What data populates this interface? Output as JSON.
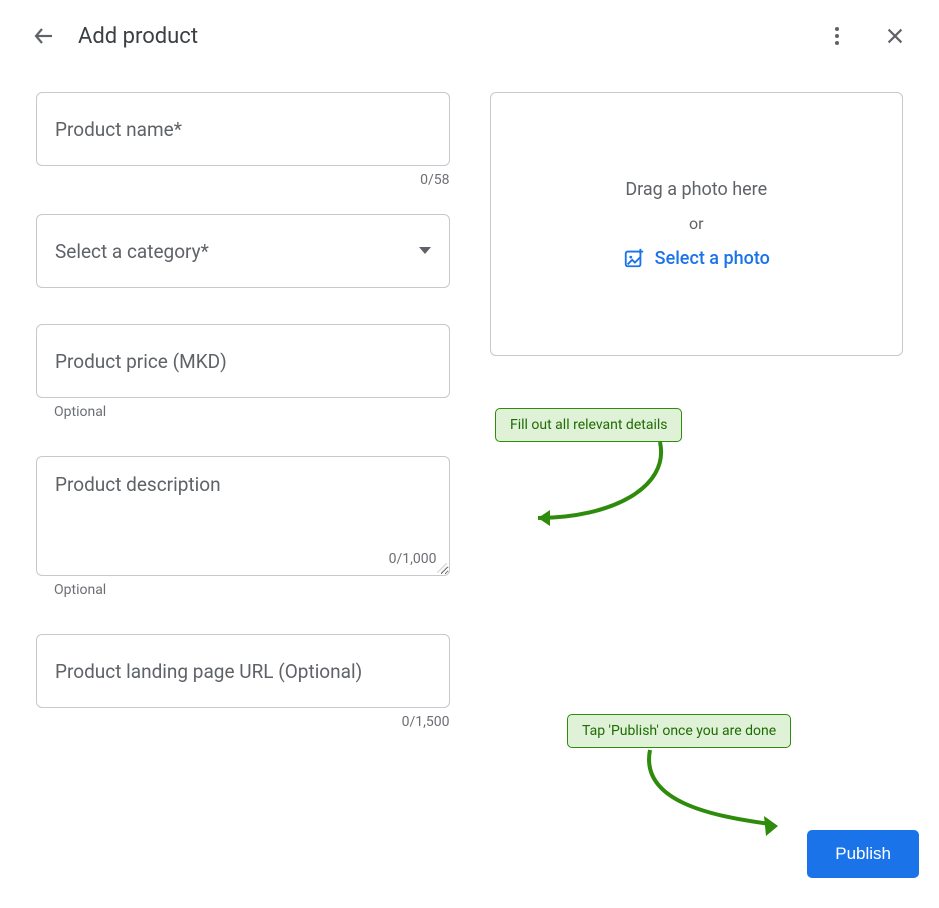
{
  "header": {
    "title": "Add product"
  },
  "fields": {
    "name": {
      "label": "Product name*",
      "counter": "0/58"
    },
    "category": {
      "label": "Select a category*"
    },
    "price": {
      "label": "Product price (MKD)",
      "helper": "Optional"
    },
    "description": {
      "label": "Product description",
      "counter": "0/1,000",
      "helper": "Optional"
    },
    "url": {
      "label": "Product landing page URL (Optional)",
      "counter": "0/1,500"
    }
  },
  "dropzone": {
    "drag_text": "Drag a photo here",
    "or_text": "or",
    "select_text": "Select a photo"
  },
  "callouts": {
    "fill_details": "Fill out all relevant details",
    "tap_publish": "Tap 'Publish' once you are done"
  },
  "actions": {
    "publish": "Publish"
  }
}
